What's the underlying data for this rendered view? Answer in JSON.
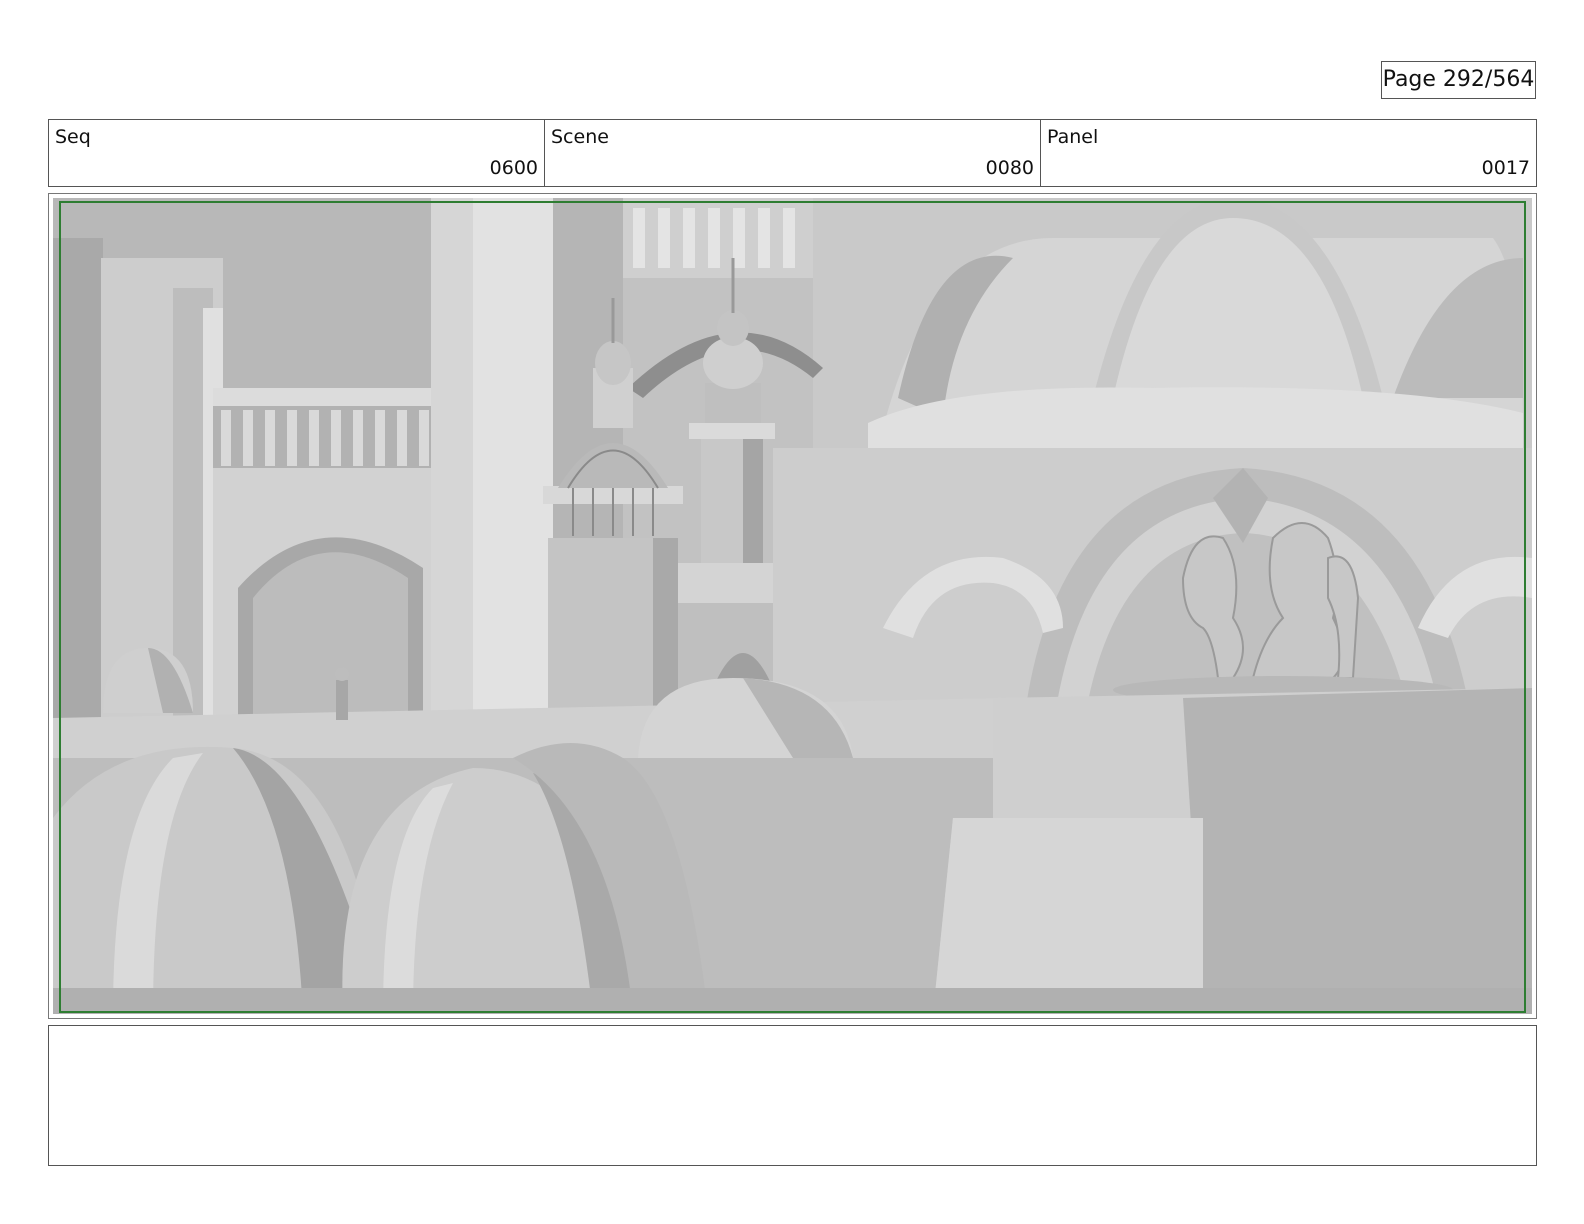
{
  "page": {
    "page_number": "Page 292/564"
  },
  "info": {
    "seq_label": "Seq",
    "seq_value": "0600",
    "scene_label": "Scene",
    "scene_value": "0080",
    "panel_label": "Panel",
    "panel_value": "0017"
  },
  "colors": {
    "safe_frame": "#2e7d32",
    "border": "#555555"
  }
}
